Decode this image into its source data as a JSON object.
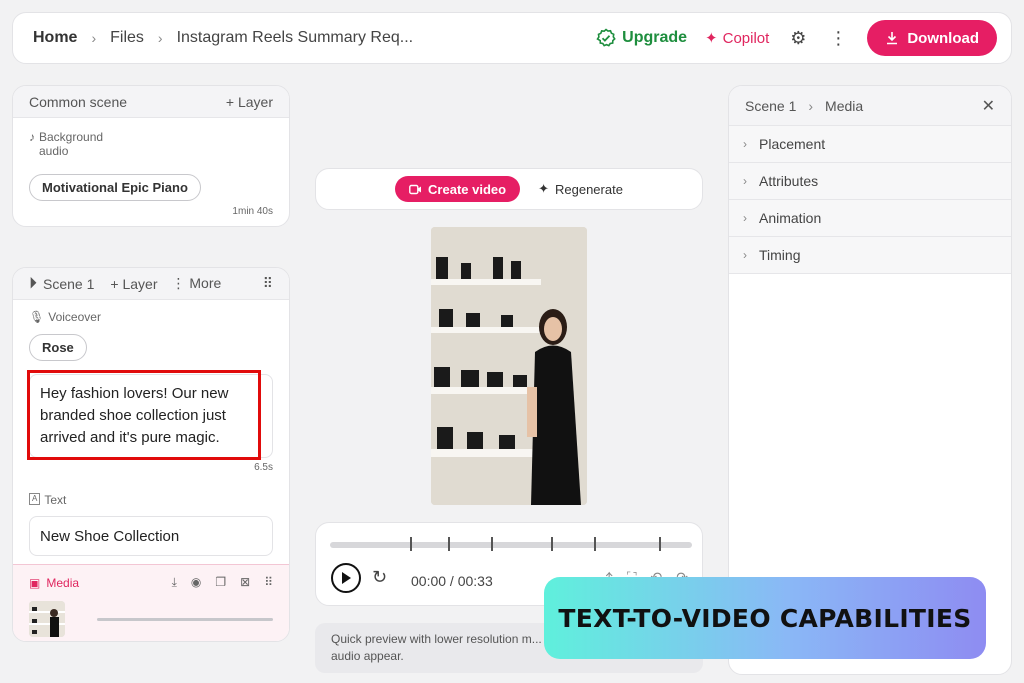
{
  "breadcrumb": {
    "home": "Home",
    "files": "Files",
    "current": "Instagram Reels Summary Req..."
  },
  "header": {
    "upgrade_label": "Upgrade",
    "copilot_label": "Copilot",
    "download_label": "Download"
  },
  "common_scene": {
    "title": "Common scene",
    "layer_label": "Layer",
    "bg_audio_label": "Background audio",
    "audio_track": "Motivational Epic Piano",
    "duration": "1min 40s"
  },
  "scene1": {
    "title": "Scene 1",
    "layer_label": "Layer",
    "more_label": "More",
    "voiceover_label": "Voiceover",
    "voice_name": "Rose",
    "voice_text": "Hey fashion lovers! Our new branded shoe collection just arrived and it's pure magic.",
    "voice_duration": "6.5s",
    "text_label": "Text",
    "text_value": "New Shoe Collection",
    "media_label": "Media"
  },
  "center": {
    "create_video_label": "Create video",
    "regenerate_label": "Regenerate",
    "time": "00:00 / 00:33",
    "note": "Quick preview with lower resolution m... blank frames or silent audio appear."
  },
  "right_panel": {
    "crumb_scene": "Scene 1",
    "crumb_media": "Media",
    "sections": [
      "Placement",
      "Attributes",
      "Animation",
      "Timing"
    ]
  },
  "overlay_badge": "TEXT-TO-VIDEO CAPABILITIES",
  "colors": {
    "accent": "#e61e64",
    "upgrade": "#1e8e3e",
    "highlight": "#e10b0b"
  }
}
